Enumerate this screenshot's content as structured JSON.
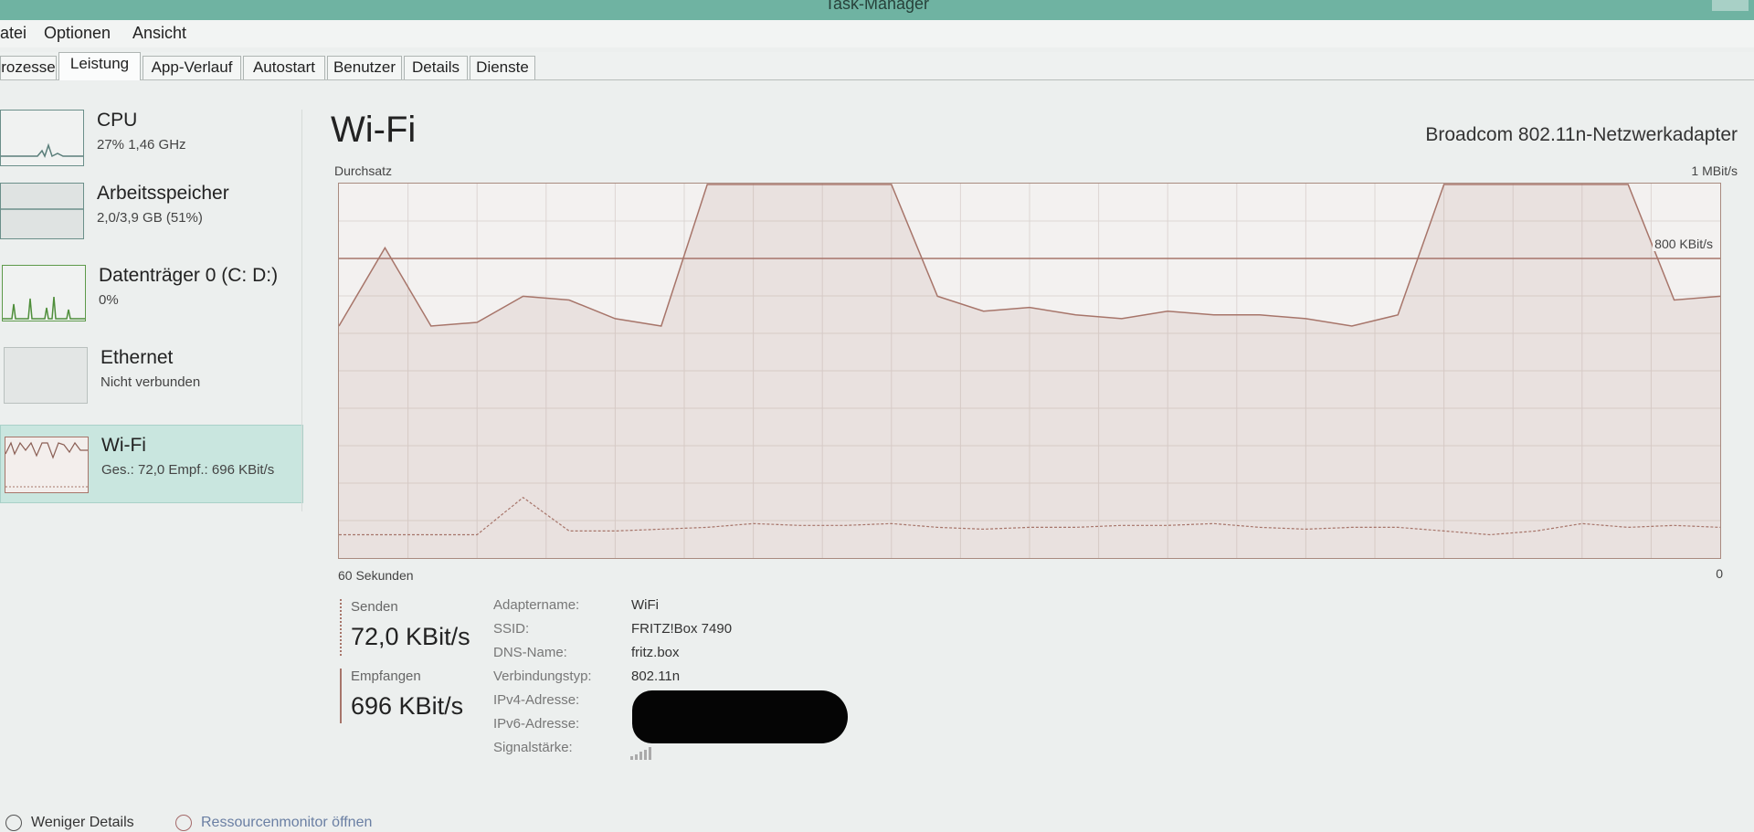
{
  "window": {
    "title": "Task-Manager"
  },
  "menu": {
    "file": "atei",
    "options": "Optionen",
    "view": "Ansicht"
  },
  "tabs": [
    "rozesse",
    "Leistung",
    "App-Verlauf",
    "Autostart",
    "Benutzer",
    "Details",
    "Dienste"
  ],
  "active_tab": "Leistung",
  "sidebar": [
    {
      "title": "CPU",
      "subtitle": "27% 1,46 GHz"
    },
    {
      "title": "Arbeitsspeicher",
      "subtitle": "2,0/3,9 GB (51%)"
    },
    {
      "title": "Datenträger 0 (C: D:)",
      "subtitle": "0%"
    },
    {
      "title": "Ethernet",
      "subtitle": "Nicht verbunden"
    },
    {
      "title": "Wi-Fi",
      "subtitle": "Ges.: 72,0 Empf.: 696 KBit/s"
    }
  ],
  "selected_sidebar_item": "Wi-Fi",
  "main": {
    "title": "Wi-Fi",
    "adapter": "Broadcom 802.11n-Netzwerkadapter",
    "graph_label": "Durchsatz",
    "graph_max": "1 MBit/s",
    "graph_ref_label": "800 KBit/s",
    "time_span": "60 Sekunden",
    "time_end": "0"
  },
  "stats": {
    "send_label": "Senden",
    "send_value": "72,0 KBit/s",
    "receive_label": "Empfangen",
    "receive_value": "696 KBit/s"
  },
  "properties": [
    {
      "key": "Adaptername:",
      "value": "WiFi"
    },
    {
      "key": "SSID:",
      "value": "FRITZ!Box 7490"
    },
    {
      "key": "DNS-Name:",
      "value": "fritz.box"
    },
    {
      "key": "Verbindungstyp:",
      "value": "802.11n"
    },
    {
      "key": "IPv4-Adresse:",
      "value": ""
    },
    {
      "key": "IPv6-Adresse:",
      "value": ""
    },
    {
      "key": "Signalstärke:",
      "value": ""
    }
  ],
  "footer": {
    "fewer_details": "Weniger Details",
    "resource_monitor": "Ressourcenmonitor öffnen"
  },
  "colors": {
    "accent": "#6fb3a2",
    "graph_line": "#a7756a",
    "selected_bg": "#c9e6df"
  },
  "chart_data": {
    "type": "line",
    "x": [
      "60",
      "58",
      "56",
      "54",
      "52",
      "50",
      "48",
      "46",
      "44",
      "42",
      "40",
      "38",
      "36",
      "34",
      "32",
      "30",
      "28",
      "26",
      "24",
      "22",
      "20",
      "18",
      "16",
      "14",
      "12",
      "10",
      "8",
      "6",
      "4",
      "2",
      "0"
    ],
    "series": [
      {
        "values": [
          620,
          830,
          620,
          630,
          700,
          690,
          640,
          620,
          1000,
          1000,
          1000,
          1000,
          1000,
          700,
          660,
          670,
          650,
          640,
          660,
          650,
          650,
          640,
          620,
          650,
          1000,
          1000,
          1000,
          1000,
          1000,
          690,
          700
        ]
      },
      {
        "values": [
          60,
          60,
          60,
          60,
          160,
          70,
          70,
          75,
          80,
          90,
          85,
          85,
          90,
          80,
          75,
          80,
          80,
          85,
          85,
          90,
          80,
          75,
          80,
          80,
          70,
          60,
          70,
          90,
          80,
          85,
          80
        ]
      }
    ],
    "ylim": [
      0,
      1000
    ]
  }
}
